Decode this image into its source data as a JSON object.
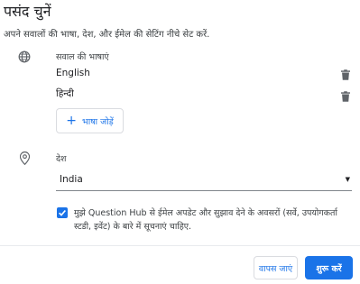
{
  "header": {
    "title": "पसंद चुनें",
    "subtitle": "अपने सवालों की भाषा, देश, और ईमेल की सेटिंग नीचे सेट करें."
  },
  "languages": {
    "label": "सवाल की भाषाएं",
    "items": [
      {
        "name": "English"
      },
      {
        "name": "हिन्दी"
      }
    ],
    "add_button_label": "भाषा जोड़ें"
  },
  "country": {
    "label": "देश",
    "selected": "India"
  },
  "email_opt_in": {
    "checked": true,
    "text": "मुझे Question Hub से ईमेल अपडेट और सुझाव देने के अवसरों (सर्वे, उपयोगकर्ता स्टडी, इवेंट) के बारे में सूचनाएं चाहिए."
  },
  "actions": {
    "back_label": "वापस जाएं",
    "start_label": "शुरू करें"
  },
  "colors": {
    "accent": "#1a73e8"
  },
  "icons": {
    "language": "globe-icon",
    "country": "location-pin-icon",
    "delete": "trash-icon",
    "add": "plus-icon",
    "dropdown": "caret-down-icon"
  }
}
